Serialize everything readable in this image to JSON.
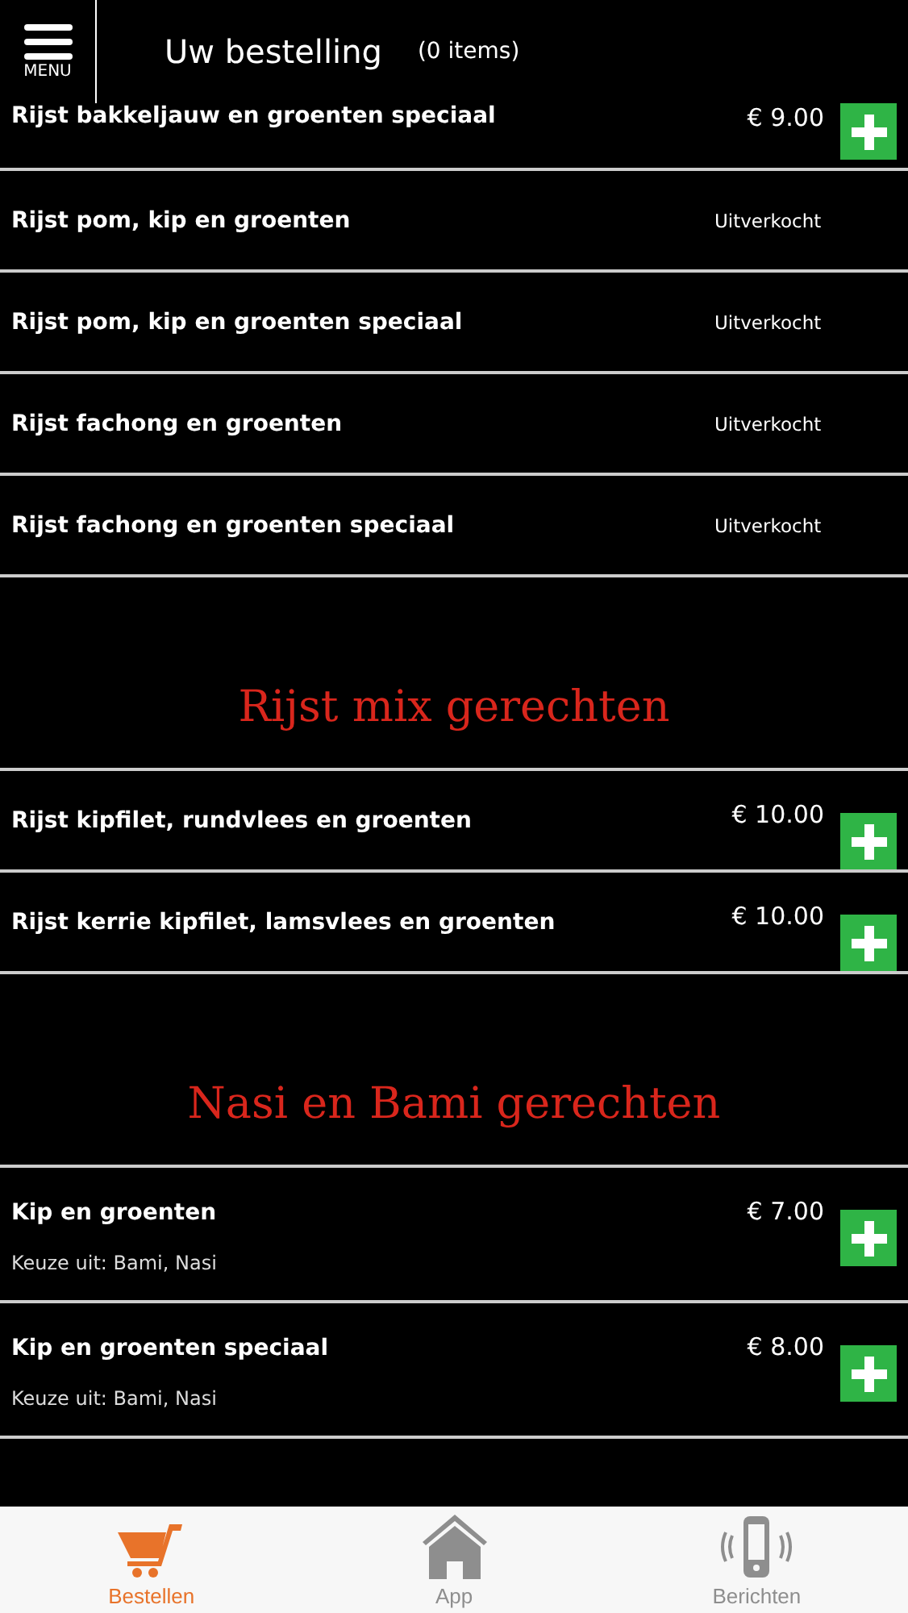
{
  "header": {
    "menu_label": "MENU",
    "title": "Uw bestelling",
    "count": "(0 items)"
  },
  "sections": [
    {
      "items": [
        {
          "name": "Rijst bakkeljauw en groenten speciaal",
          "kind": "price",
          "price": "€ 9.00"
        },
        {
          "name": "Rijst pom, kip en groenten",
          "kind": "soldout",
          "status": "Uitverkocht"
        },
        {
          "name": "Rijst pom, kip en groenten speciaal",
          "kind": "soldout",
          "status": "Uitverkocht"
        },
        {
          "name": "Rijst fachong en groenten",
          "kind": "soldout",
          "status": "Uitverkocht"
        },
        {
          "name": "Rijst fachong en groenten speciaal",
          "kind": "soldout",
          "status": "Uitverkocht"
        }
      ]
    },
    {
      "title": "Rijst mix gerechten",
      "items": [
        {
          "name": "Rijst kipfilet, rundvlees en groenten",
          "kind": "price",
          "price": "€ 10.00"
        },
        {
          "name": "Rijst kerrie kipfilet, lamsvlees en groenten",
          "kind": "price",
          "price": "€ 10.00"
        }
      ]
    },
    {
      "title": "Nasi en Bami gerechten",
      "items": [
        {
          "name": "Kip en groenten",
          "kind": "price",
          "price": "€ 7.00",
          "note": "Keuze uit: Bami, Nasi"
        },
        {
          "name": "Kip en groenten speciaal",
          "kind": "price",
          "price": "€ 8.00",
          "note": "Keuze uit: Bami, Nasi"
        }
      ]
    }
  ],
  "tabs": [
    {
      "label": "Bestellen",
      "selected": true
    },
    {
      "label": "App",
      "selected": false
    },
    {
      "label": "Berichten",
      "selected": false
    }
  ]
}
